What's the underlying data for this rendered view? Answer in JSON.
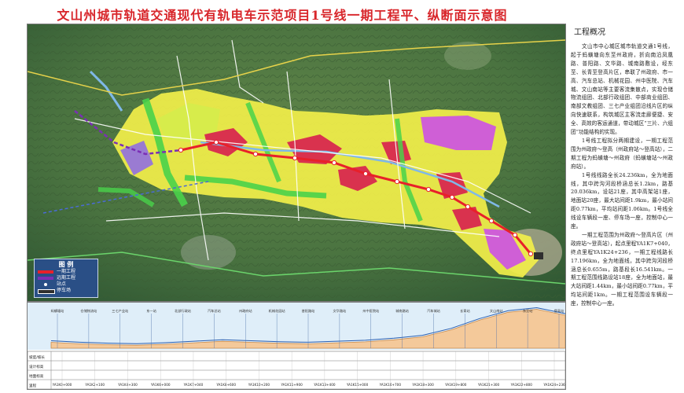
{
  "title": "文山州城市轨道交通现代有轨电车示范项目1号线一期工程平、纵断面示意图",
  "legend": {
    "title": "图 例",
    "items": [
      {
        "label": "一期工程",
        "color": "#e8202a"
      },
      {
        "label": "远期工程",
        "color": "#7b2fb5"
      },
      {
        "label": "站点",
        "color": "#ffffff"
      },
      {
        "label": "停车场",
        "color": "#2f2f2f"
      }
    ]
  },
  "colors": {
    "residential": "#f2ef4a",
    "commercial": "#d9324e",
    "green": "#49d24a",
    "public": "#cf5fd6",
    "industrial": "#b99a73",
    "water": "#7fb8e8",
    "line_phase1": "#e8202a",
    "line_future": "#7b2fb5",
    "road": "#ffffff"
  },
  "overview": {
    "title": "工程概况",
    "paragraphs": [
      "文山市中心城区城市轨道交通1号线，起于蚂蟥塘向东至州政府，折向南沿凤凰路、普阳路、文华路、城南路敷设，经东至、长青至登高片区，串联了州政府、市一高、汽车总站、机械花园、州中医院、汽车城、文山南站等主要客流集散点，实现仓储物流组团、北部行政组团、中部商业组团、南部文教组团、三七产业组团沿线片区的纵向快速联系，构筑城区主客流走廊便捷、安全、高效的客运通道，带动城区“三片、六组团”功能结构的实现。",
      "1号线工程拟分两期建设，一期工程范围为州政府～登高（州政府站～登高站），二期工程为蚂蟥塘～州政府（蚂蟥塘站～州政府站）。",
      "1号线线路全长24.236km，全为地面线，其中跨沟河段桥涵总长1.2km，路基20.036km，设站21座，其中高架站1座，地面站20座，最大站间距1.9km，最小站间距0.77km，平均站间距1.06km。1号线全线设车辆段一座、停车场一座，控制中心一座。",
      "一期工程范围为州政府～登高片区（州政府站～登高站），起点里程YA1K7+040，终点里程YA1K24+236，一期工程线路长17.196km，全为地面线，其中跨沟河段桥涵总长0.655m，路基段长16.541km。一期工程范围线路设站18座，全为地面站，最大站间距1.44km，最小站间距0.77km，平均站间距1km。一期工程范围设车辆段一座，控制中心一座。"
    ]
  },
  "profile": {
    "stations": [
      "蚂蟥塘站",
      "仓储物流站",
      "三七产业站",
      "东一站",
      "北部行政站",
      "汽车总站",
      "州政府站",
      "机械花园站",
      "普阳路站",
      "文华路站",
      "州中医院站",
      "城南路站",
      "汽车城站",
      "长青站",
      "文山南站",
      "东至站",
      "登高站"
    ],
    "mileage": [
      "YA1K0+000",
      "YA1K2+100",
      "YA1K4+300",
      "YA1K6+000",
      "YA1K7+040",
      "YA1K8+600",
      "YA1K10+200",
      "YA1K11+900",
      "YA1K13+400",
      "YA1K15+000",
      "YA1K16+700",
      "YA1K18+300",
      "YA1K19+800",
      "YA1K21+300",
      "YA1K22+800",
      "YA1K24+236"
    ],
    "elevation": [
      1285,
      1282,
      1280,
      1279,
      1281,
      1284,
      1287,
      1285,
      1283,
      1282,
      1284,
      1286,
      1290,
      1296,
      1310,
      1330,
      1346,
      1352,
      1340
    ],
    "row_labels": [
      "坡度/坡长",
      "设计标高",
      "地面标高",
      "里程"
    ]
  }
}
